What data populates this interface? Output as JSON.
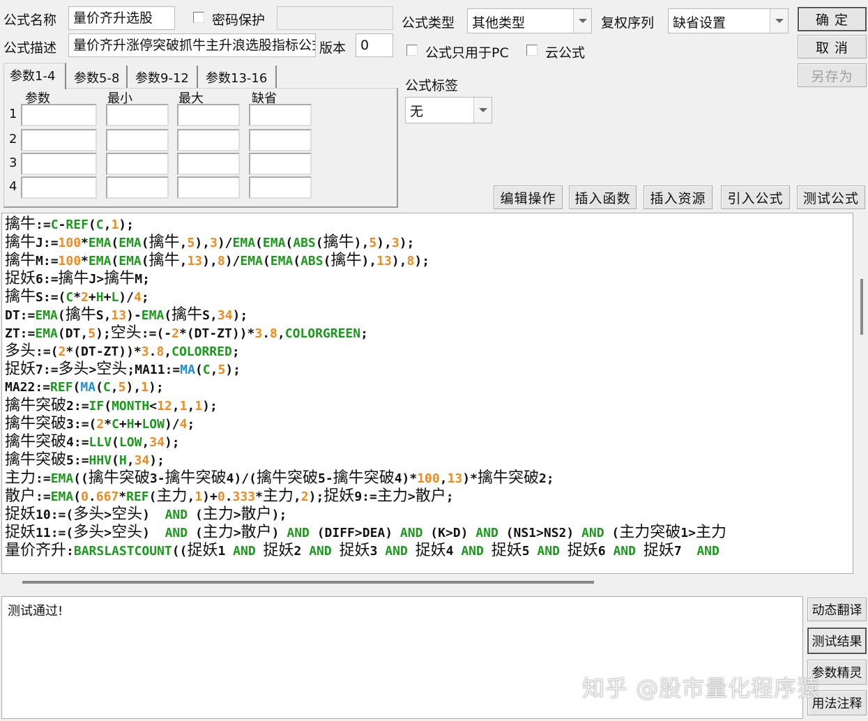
{
  "header": {
    "name_label": "公式名称",
    "name_value": "量价齐升选股",
    "password_label": "密码保护",
    "password_value": "",
    "desc_label": "公式描述",
    "desc_value": "量价齐升涨停突破抓牛主升浪选股指标公式",
    "version_label": "版本",
    "version_value": "0",
    "type_label": "公式类型",
    "type_value": "其他类型",
    "restore_label": "复权序列",
    "restore_value": "缺省设置",
    "pc_only_label": "公式只用于PC",
    "cloud_label": "云公式",
    "tag_label": "公式标签",
    "tag_value": "无"
  },
  "buttons": {
    "ok": "确 定",
    "cancel": "取 消",
    "save_as": "另存为",
    "edit_ops": "编辑操作",
    "insert_func": "插入函数",
    "insert_res": "插入资源",
    "import_formula": "引入公式",
    "test_formula": "测试公式",
    "dyn_translate": "动态翻译",
    "test_result": "测试结果",
    "param_wizard": "参数精灵",
    "usage_notes": "用法注释"
  },
  "params": {
    "tabs": [
      "参数1-4",
      "参数5-8",
      "参数9-12",
      "参数13-16"
    ],
    "columns": [
      "参数",
      "最小",
      "最大",
      "缺省"
    ],
    "rows": [
      "1",
      "2",
      "3",
      "4"
    ]
  },
  "code_lines": [
    [
      [
        "t",
        "擒牛"
      ],
      [
        "s",
        ":="
      ],
      [
        "f",
        "C"
      ],
      [
        "s",
        "-"
      ],
      [
        "f",
        "REF"
      ],
      [
        "s",
        "("
      ],
      [
        "f",
        "C"
      ],
      [
        "s",
        ","
      ],
      [
        "n",
        "1"
      ],
      [
        "s",
        ");"
      ]
    ],
    [
      [
        "t",
        "擒牛"
      ],
      [
        "s",
        "J:="
      ],
      [
        "n",
        "100"
      ],
      [
        "s",
        "*"
      ],
      [
        "f",
        "EMA"
      ],
      [
        "s",
        "("
      ],
      [
        "f",
        "EMA"
      ],
      [
        "s",
        "("
      ],
      [
        "t",
        "擒牛"
      ],
      [
        "s",
        ","
      ],
      [
        "n",
        "5"
      ],
      [
        "s",
        "),"
      ],
      [
        "n",
        "3"
      ],
      [
        "s",
        ")/"
      ],
      [
        "f",
        "EMA"
      ],
      [
        "s",
        "("
      ],
      [
        "f",
        "EMA"
      ],
      [
        "s",
        "("
      ],
      [
        "f",
        "ABS"
      ],
      [
        "s",
        "("
      ],
      [
        "t",
        "擒牛"
      ],
      [
        "s",
        "),"
      ],
      [
        "n",
        "5"
      ],
      [
        "s",
        "),"
      ],
      [
        "n",
        "3"
      ],
      [
        "s",
        ");"
      ]
    ],
    [
      [
        "t",
        "擒牛"
      ],
      [
        "s",
        "M:="
      ],
      [
        "n",
        "100"
      ],
      [
        "s",
        "*"
      ],
      [
        "f",
        "EMA"
      ],
      [
        "s",
        "("
      ],
      [
        "f",
        "EMA"
      ],
      [
        "s",
        "("
      ],
      [
        "t",
        "擒牛"
      ],
      [
        "s",
        ","
      ],
      [
        "n",
        "13"
      ],
      [
        "s",
        "),"
      ],
      [
        "n",
        "8"
      ],
      [
        "s",
        ")/"
      ],
      [
        "f",
        "EMA"
      ],
      [
        "s",
        "("
      ],
      [
        "f",
        "EMA"
      ],
      [
        "s",
        "("
      ],
      [
        "f",
        "ABS"
      ],
      [
        "s",
        "("
      ],
      [
        "t",
        "擒牛"
      ],
      [
        "s",
        "),"
      ],
      [
        "n",
        "13"
      ],
      [
        "s",
        "),"
      ],
      [
        "n",
        "8"
      ],
      [
        "s",
        ");"
      ]
    ],
    [
      [
        "t",
        "捉妖"
      ],
      [
        "s",
        "6:="
      ],
      [
        "t",
        "擒牛"
      ],
      [
        "s",
        "J>"
      ],
      [
        "t",
        "擒牛"
      ],
      [
        "s",
        "M;"
      ]
    ],
    [
      [
        "t",
        "擒牛"
      ],
      [
        "s",
        "S:=("
      ],
      [
        "f",
        "C"
      ],
      [
        "s",
        "*"
      ],
      [
        "n",
        "2"
      ],
      [
        "s",
        "+"
      ],
      [
        "f",
        "H"
      ],
      [
        "s",
        "+"
      ],
      [
        "f",
        "L"
      ],
      [
        "s",
        ")/"
      ],
      [
        "n",
        "4"
      ],
      [
        "s",
        ";"
      ]
    ],
    [
      [
        "s",
        "DT:="
      ],
      [
        "f",
        "EMA"
      ],
      [
        "s",
        "("
      ],
      [
        "t",
        "擒牛"
      ],
      [
        "s",
        "S,"
      ],
      [
        "n",
        "13"
      ],
      [
        "s",
        ")-"
      ],
      [
        "f",
        "EMA"
      ],
      [
        "s",
        "("
      ],
      [
        "t",
        "擒牛"
      ],
      [
        "s",
        "S,"
      ],
      [
        "n",
        "34"
      ],
      [
        "s",
        ");"
      ]
    ],
    [
      [
        "s",
        "ZT:="
      ],
      [
        "f",
        "EMA"
      ],
      [
        "s",
        "(DT,"
      ],
      [
        "n",
        "5"
      ],
      [
        "s",
        ");"
      ],
      [
        "t",
        "空头"
      ],
      [
        "s",
        ":=(-"
      ],
      [
        "n",
        "2"
      ],
      [
        "s",
        "*(DT-ZT))*"
      ],
      [
        "n",
        "3"
      ],
      [
        "s",
        "."
      ],
      [
        "n",
        "8"
      ],
      [
        "s",
        ","
      ],
      [
        "f",
        "COLORGREEN"
      ],
      [
        "s",
        ";"
      ]
    ],
    [
      [
        "t",
        "多头"
      ],
      [
        "s",
        ":=("
      ],
      [
        "n",
        "2"
      ],
      [
        "s",
        "*(DT-ZT))*"
      ],
      [
        "n",
        "3"
      ],
      [
        "s",
        "."
      ],
      [
        "n",
        "8"
      ],
      [
        "s",
        ","
      ],
      [
        "f",
        "COLORRED"
      ],
      [
        "s",
        ";"
      ]
    ],
    [
      [
        "t",
        "捉妖"
      ],
      [
        "s",
        "7:="
      ],
      [
        "t",
        "多头"
      ],
      [
        "s",
        ">"
      ],
      [
        "t",
        "空头"
      ],
      [
        "s",
        ";MA11:="
      ],
      [
        "b",
        "MA"
      ],
      [
        "s",
        "("
      ],
      [
        "f",
        "C"
      ],
      [
        "s",
        ","
      ],
      [
        "n",
        "5"
      ],
      [
        "s",
        ");"
      ]
    ],
    [
      [
        "s",
        "MA22:="
      ],
      [
        "f",
        "REF"
      ],
      [
        "s",
        "("
      ],
      [
        "b",
        "MA"
      ],
      [
        "s",
        "("
      ],
      [
        "f",
        "C"
      ],
      [
        "s",
        ","
      ],
      [
        "n",
        "5"
      ],
      [
        "s",
        "),"
      ],
      [
        "n",
        "1"
      ],
      [
        "s",
        ");"
      ]
    ],
    [
      [
        "t",
        "擒牛突破"
      ],
      [
        "s",
        "2:="
      ],
      [
        "f",
        "IF"
      ],
      [
        "s",
        "("
      ],
      [
        "f",
        "MONTH"
      ],
      [
        "s",
        "<"
      ],
      [
        "n",
        "12"
      ],
      [
        "s",
        ","
      ],
      [
        "n",
        "1"
      ],
      [
        "s",
        ","
      ],
      [
        "n",
        "1"
      ],
      [
        "s",
        ");"
      ]
    ],
    [
      [
        "t",
        "擒牛突破"
      ],
      [
        "s",
        "3:=("
      ],
      [
        "n",
        "2"
      ],
      [
        "s",
        "*"
      ],
      [
        "f",
        "C"
      ],
      [
        "s",
        "+"
      ],
      [
        "f",
        "H"
      ],
      [
        "s",
        "+"
      ],
      [
        "f",
        "LOW"
      ],
      [
        "s",
        ")/"
      ],
      [
        "n",
        "4"
      ],
      [
        "s",
        ";"
      ]
    ],
    [
      [
        "t",
        "擒牛突破"
      ],
      [
        "s",
        "4:="
      ],
      [
        "f",
        "LLV"
      ],
      [
        "s",
        "("
      ],
      [
        "f",
        "LOW"
      ],
      [
        "s",
        ","
      ],
      [
        "n",
        "34"
      ],
      [
        "s",
        ");"
      ]
    ],
    [
      [
        "t",
        "擒牛突破"
      ],
      [
        "s",
        "5:="
      ],
      [
        "f",
        "HHV"
      ],
      [
        "s",
        "("
      ],
      [
        "f",
        "H"
      ],
      [
        "s",
        ","
      ],
      [
        "n",
        "34"
      ],
      [
        "s",
        ");"
      ]
    ],
    [
      [
        "t",
        "主力"
      ],
      [
        "s",
        ":="
      ],
      [
        "f",
        "EMA"
      ],
      [
        "s",
        "(("
      ],
      [
        "t",
        "擒牛突破"
      ],
      [
        "s",
        "3-"
      ],
      [
        "t",
        "擒牛突破"
      ],
      [
        "s",
        "4)/("
      ],
      [
        "t",
        "擒牛突破"
      ],
      [
        "s",
        "5-"
      ],
      [
        "t",
        "擒牛突破"
      ],
      [
        "s",
        "4)*"
      ],
      [
        "n",
        "100"
      ],
      [
        "s",
        ","
      ],
      [
        "n",
        "13"
      ],
      [
        "s",
        ")*"
      ],
      [
        "t",
        "擒牛突破"
      ],
      [
        "s",
        "2;"
      ]
    ],
    [
      [
        "t",
        "散户"
      ],
      [
        "s",
        ":="
      ],
      [
        "f",
        "EMA"
      ],
      [
        "s",
        "("
      ],
      [
        "n",
        "0"
      ],
      [
        "s",
        "."
      ],
      [
        "n",
        "667"
      ],
      [
        "s",
        "*"
      ],
      [
        "f",
        "REF"
      ],
      [
        "s",
        "("
      ],
      [
        "t",
        "主力"
      ],
      [
        "s",
        ","
      ],
      [
        "n",
        "1"
      ],
      [
        "s",
        ")+"
      ],
      [
        "n",
        "0"
      ],
      [
        "s",
        "."
      ],
      [
        "n",
        "333"
      ],
      [
        "s",
        "*"
      ],
      [
        "t",
        "主力"
      ],
      [
        "s",
        ","
      ],
      [
        "n",
        "2"
      ],
      [
        "s",
        ");"
      ],
      [
        "t",
        "捉妖"
      ],
      [
        "s",
        "9:="
      ],
      [
        "t",
        "主力"
      ],
      [
        "s",
        ">"
      ],
      [
        "t",
        "散户"
      ],
      [
        "s",
        ";"
      ]
    ],
    [
      [
        "t",
        "捉妖"
      ],
      [
        "s",
        "10:=("
      ],
      [
        "t",
        "多头"
      ],
      [
        "s",
        ">"
      ],
      [
        "t",
        "空头"
      ],
      [
        "s",
        ")  "
      ],
      [
        "f",
        "AND"
      ],
      [
        "s",
        " ("
      ],
      [
        "t",
        "主力"
      ],
      [
        "s",
        ">"
      ],
      [
        "t",
        "散户"
      ],
      [
        "s",
        ");"
      ]
    ],
    [
      [
        "t",
        "捉妖"
      ],
      [
        "s",
        "11:=("
      ],
      [
        "t",
        "多头"
      ],
      [
        "s",
        ">"
      ],
      [
        "t",
        "空头"
      ],
      [
        "s",
        ")  "
      ],
      [
        "f",
        "AND"
      ],
      [
        "s",
        " ("
      ],
      [
        "t",
        "主力"
      ],
      [
        "s",
        ">"
      ],
      [
        "t",
        "散户"
      ],
      [
        "s",
        ") "
      ],
      [
        "f",
        "AND"
      ],
      [
        "s",
        " (DIFF>DEA) "
      ],
      [
        "f",
        "AND"
      ],
      [
        "s",
        " (K>D) "
      ],
      [
        "f",
        "AND"
      ],
      [
        "s",
        " (NS1>NS2) "
      ],
      [
        "f",
        "AND"
      ],
      [
        "s",
        " ("
      ],
      [
        "t",
        "主力突破"
      ],
      [
        "s",
        "1>"
      ],
      [
        "t",
        "主力"
      ]
    ],
    [
      [
        "t",
        "量价齐升"
      ],
      [
        "s",
        ":"
      ],
      [
        "f",
        "BARSLASTCOUNT"
      ],
      [
        "s",
        "(("
      ],
      [
        "t",
        "捉妖"
      ],
      [
        "s",
        "1 "
      ],
      [
        "f",
        "AND"
      ],
      [
        "s",
        " "
      ],
      [
        "t",
        "捉妖"
      ],
      [
        "s",
        "2 "
      ],
      [
        "f",
        "AND"
      ],
      [
        "s",
        " "
      ],
      [
        "t",
        "捉妖"
      ],
      [
        "s",
        "3 "
      ],
      [
        "f",
        "AND"
      ],
      [
        "s",
        " "
      ],
      [
        "t",
        "捉妖"
      ],
      [
        "s",
        "4 "
      ],
      [
        "f",
        "AND"
      ],
      [
        "s",
        " "
      ],
      [
        "t",
        "捉妖"
      ],
      [
        "s",
        "5 "
      ],
      [
        "f",
        "AND"
      ],
      [
        "s",
        " "
      ],
      [
        "t",
        "捉妖"
      ],
      [
        "s",
        "6 "
      ],
      [
        "f",
        "AND"
      ],
      [
        "s",
        " "
      ],
      [
        "t",
        "捉妖"
      ],
      [
        "s",
        "7  "
      ],
      [
        "f",
        "AND"
      ]
    ]
  ],
  "output": {
    "message": "测试通过!"
  },
  "watermark": "知乎 @股市量化程序猿",
  "scroll": {
    "vertical_position": 0.2,
    "horizontal_visible_fraction": 0.68
  }
}
